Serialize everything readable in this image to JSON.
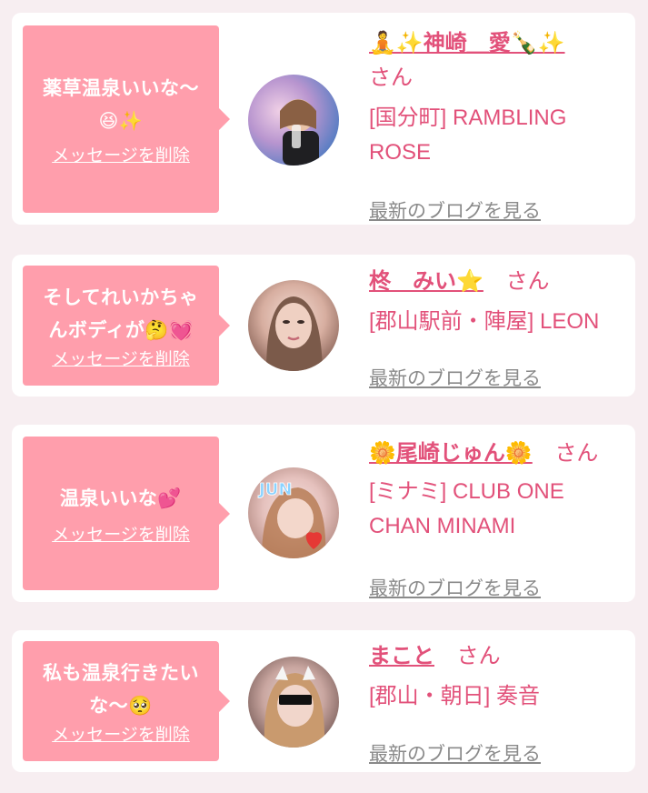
{
  "cards": [
    {
      "message_line1": "薬草温泉いいな〜",
      "message_line2": "😆✨",
      "delete_label": "メッセージを削除",
      "name_line": "🧘✨神崎＿愛🍾✨",
      "san": "さん",
      "shop": "[国分町] RAMBLING ROSE",
      "blog_label": "最新のブログを見る",
      "avatar_colors": [
        "#c7a6d8",
        "#6b86c9"
      ]
    },
    {
      "message_line1": "そしてれいかちゃ",
      "message_line2": "んボディが🤔💓",
      "delete_label": "メッセージを削除",
      "name": "柊　みい⭐",
      "san": "さん",
      "shop": "[郡山駅前・陣屋] LEON",
      "blog_label": "最新のブログを見る",
      "avatar_colors": [
        "#d9b3a4",
        "#7a5a4e"
      ]
    },
    {
      "message_line1": "温泉いいな💕",
      "delete_label": "メッセージを削除",
      "name": "🌼尾崎じゅん🌼",
      "san": "さん",
      "shop": "[ミナミ] CLUB ONE CHAN MINAMI",
      "blog_label": "最新のブログを見る",
      "avatar_text": "JUN",
      "avatar_colors": [
        "#e8c3c3",
        "#c9978a"
      ]
    },
    {
      "message_line1": "私も温泉行きたい",
      "message_line2": "な〜🥺",
      "delete_label": "メッセージを削除",
      "name": "まこと",
      "san": "さん",
      "shop": "[郡山・朝日] 奏音",
      "blog_label": "最新のブログを見る",
      "avatar_colors": [
        "#caa9a3",
        "#5a4442"
      ]
    }
  ]
}
